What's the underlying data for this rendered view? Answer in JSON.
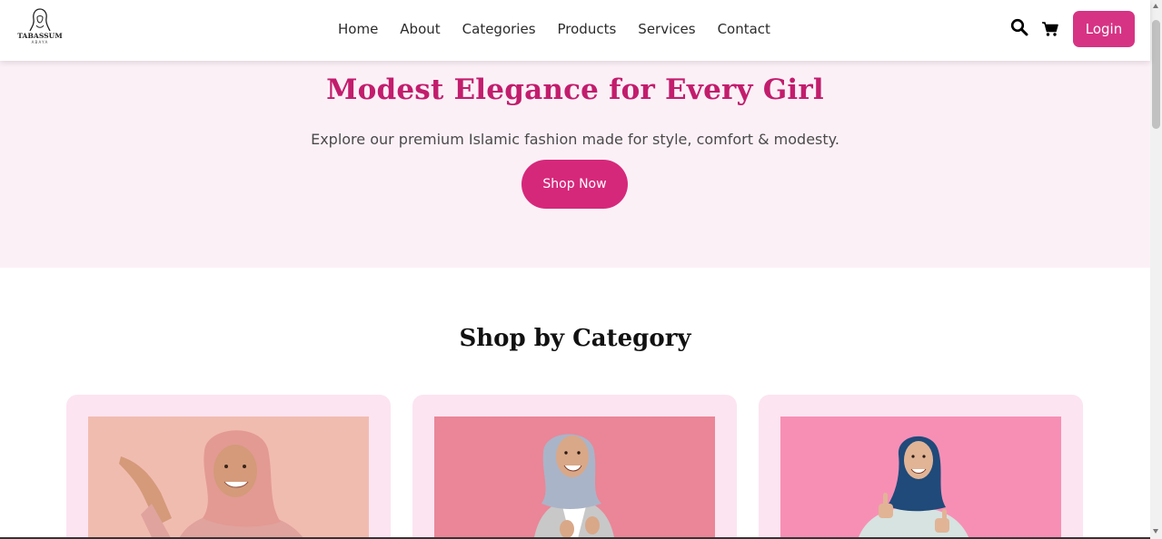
{
  "header": {
    "logo": {
      "name": "TABASSUM",
      "sub": "ABAYA"
    },
    "nav": [
      "Home",
      "About",
      "Categories",
      "Products",
      "Services",
      "Contact"
    ],
    "icons": {
      "search": "search-icon",
      "cart": "cart-icon"
    },
    "login_label": "Login"
  },
  "hero": {
    "title": "Modest Elegance for Every Girl",
    "subtitle": "Explore our premium Islamic fashion made for style, comfort & modesty.",
    "cta": "Shop Now"
  },
  "categories": {
    "title": "Shop by Category"
  },
  "colors": {
    "accent": "#d63384",
    "hero_title": "#c21d6d",
    "hero_bg": "#fcf0f7",
    "card_bg": "#fce4f1"
  }
}
